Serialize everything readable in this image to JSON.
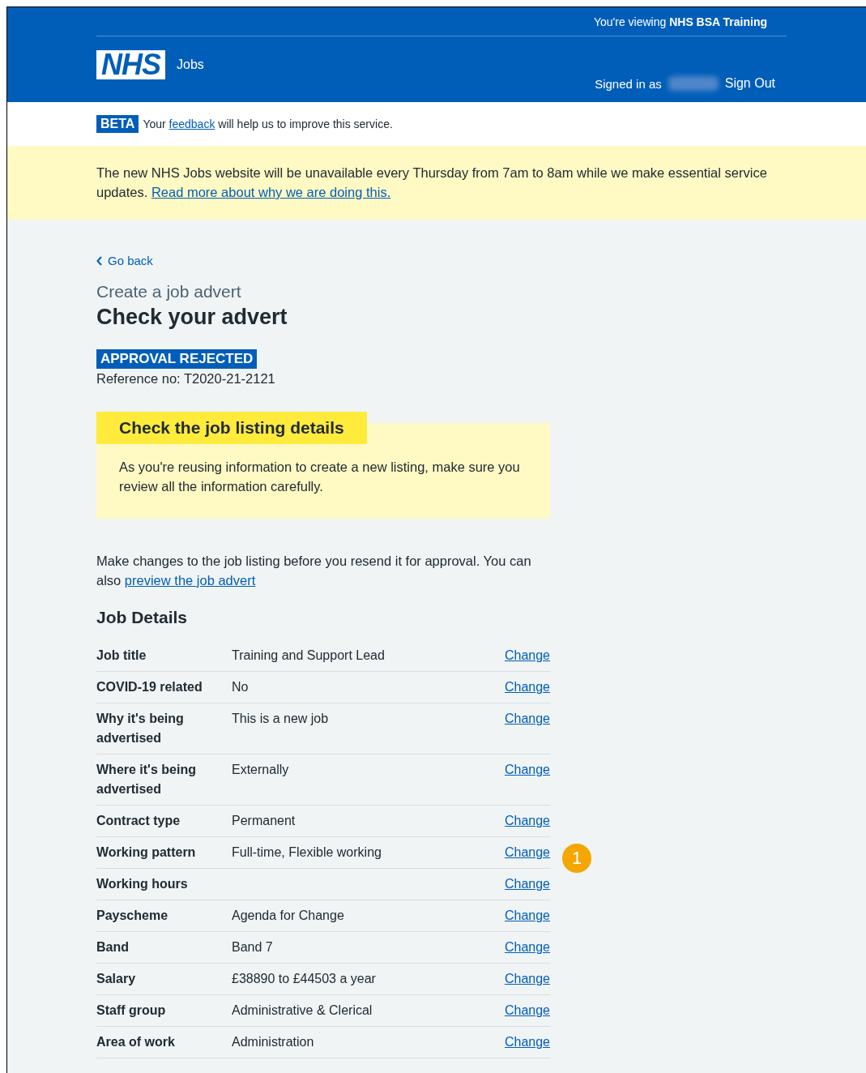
{
  "header": {
    "viewing": "You're viewing **NHS BSA Training**",
    "logo": "NHS",
    "service": "Jobs",
    "signed_in": "Signed in as",
    "sign_out": "Sign Out"
  },
  "beta": {
    "tag": "BETA",
    "before": "Your",
    "link": "feedback",
    "after": "will help us to improve this service."
  },
  "notice": {
    "text": "The new NHS Jobs website will be unavailable every Thursday from 7am to 8am while we make essential service updates.",
    "link": "Read more about why we are doing this."
  },
  "back": "Go back",
  "caption": "Create a job advert",
  "title": "Check your advert",
  "status_tag": "APPROVAL REJECTED",
  "reference": "Reference no: T2020-21-2121",
  "callout": {
    "heading": "Check the job listing details",
    "body": "As you're reusing information to create a new listing, make sure you review all the information carefully."
  },
  "intro": {
    "text": "Make changes to the job listing before you resend it for approval. You can also",
    "link": "preview the job advert"
  },
  "section_title": "Job Details",
  "rows": [
    {
      "key": "Job title",
      "value": "Training and Support Lead",
      "action": "Change"
    },
    {
      "key": "COVID-19 related",
      "value": "No",
      "action": "Change"
    },
    {
      "key": "Why it's being advertised",
      "value": "This is a new job",
      "action": "Change"
    },
    {
      "key": "Where it's being advertised",
      "value": "Externally",
      "action": "Change"
    },
    {
      "key": "Contract type",
      "value": "Permanent",
      "action": "Change"
    },
    {
      "key": "Working pattern",
      "value": "Full-time, Flexible working",
      "action": "Change",
      "marker": "1"
    },
    {
      "key": "Working hours",
      "action": "Change"
    },
    {
      "key": "Payscheme",
      "value": "Agenda for Change",
      "action": "Change"
    },
    {
      "key": "Band",
      "value": "Band 7",
      "action": "Change"
    },
    {
      "key": "Salary",
      "value": "£38890 to £44503 a year",
      "action": "Change"
    },
    {
      "key": "Staff group",
      "value": "Administrative & Clerical",
      "action": "Change"
    },
    {
      "key": "Area of work",
      "value": "Administration",
      "action": "Change"
    }
  ]
}
